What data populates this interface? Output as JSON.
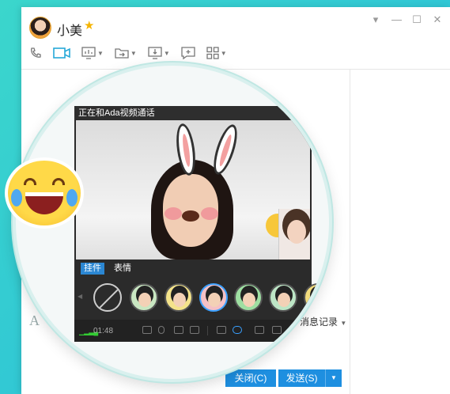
{
  "window": {
    "contact_name": "小美",
    "controls": [
      "▾",
      "—",
      "☐",
      "✕"
    ],
    "toolbar_items": [
      "phone-icon",
      "video-call-icon",
      "screen-share-icon",
      "file-transfer-icon",
      "remote-desktop-icon",
      "new-chat-icon",
      "apps-icon"
    ],
    "font_icon": "A",
    "history_label": "消息记录",
    "buttons": {
      "close": "关闭(C)",
      "send": "发送(S)"
    }
  },
  "video_call": {
    "title": "正在和Ada视频通话",
    "tabs": [
      "挂件",
      "表情"
    ],
    "active_tab": "挂件",
    "duration": "01:48"
  },
  "colors": {
    "accent": "#1e8fe0",
    "tab_active": "#2b87d3",
    "background": "#3bd6cc"
  }
}
